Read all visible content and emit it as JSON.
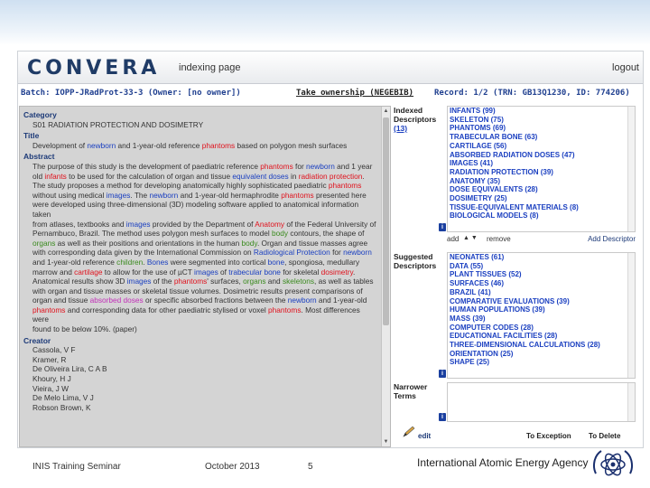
{
  "header": {
    "logo_text": "CONVERA",
    "title": "indexing page",
    "logout": "logout"
  },
  "infobar": {
    "batch": "Batch: IOPP-JRadProt-33-3 (Owner: [no owner])",
    "take_ownership": "Take ownership (NEGEBIB)",
    "record": "Record: 1/2 (TRN: GB13Q1230, ID: 774206)"
  },
  "record": {
    "category_label": "Category",
    "category_value": "S01 RADIATION PROTECTION AND DOSIMETRY",
    "title_label": "Title",
    "title_parts": [
      "Development of ",
      "newborn",
      " and 1-year-old reference ",
      "phantoms",
      " based on polygon mesh surfaces"
    ],
    "abstract_label": "Abstract",
    "abstract_lines": [
      [
        "The purpose of this study is the development of paediatric reference ",
        "phantoms",
        " for ",
        "newborn",
        " and 1 year"
      ],
      [
        "old ",
        "infants",
        " to be used for the calculation of organ and tissue ",
        "equivalent doses",
        " in ",
        "radiation protection",
        "."
      ],
      [
        "The study proposes a method for developing anatomically highly sophisticated paediatric ",
        "phantoms"
      ],
      [
        "without using medical ",
        "images",
        ". The ",
        "newborn",
        " and 1-year-old hermaphrodite ",
        "phantoms",
        " presented here"
      ],
      [
        "were developed using three-dimensional (3D) modeling software applied to anatomical information taken"
      ],
      [
        "from atlases, textbooks and ",
        "images",
        " provided by the Department of ",
        "Anatomy",
        " of the Federal University of"
      ],
      [
        "Pernambuco, Brazil. The method uses polygon mesh surfaces to model ",
        "body",
        " contours, the shape of"
      ],
      [
        "organs",
        " as well as their positions and orientations in the human ",
        "body",
        ". Organ and tissue masses agree"
      ],
      [
        "with corresponding data given by the International Commission on ",
        "Radiological Protection",
        " for ",
        "newborn"
      ],
      [
        "and 1-year-old reference ",
        "children",
        ". ",
        "Bones",
        " were segmented into cortical ",
        "bone",
        ", spongiosa, medullary"
      ],
      [
        "marrow and ",
        "cartilage",
        " to allow for the use of µCT ",
        "images",
        " of ",
        "trabecular bone",
        " for skeletal ",
        "dosimetry",
        "."
      ],
      [
        "Anatomical results show 3D ",
        "images",
        " of the ",
        "phantoms",
        "' surfaces, ",
        "organs",
        " and ",
        "skeletons",
        ", as well as tables"
      ],
      [
        "with organ and tissue masses or skeletal tissue volumes. Dosimetric results present comparisons of"
      ],
      [
        "organ and tissue ",
        "absorbed doses",
        " or specific absorbed fractions between the ",
        "newborn",
        " and 1-year-old"
      ],
      [
        "phantoms",
        " and corresponding data for other paediatric stylised or voxel ",
        "phantoms",
        ". Most differences were"
      ],
      [
        "found to be below 10%. (paper)"
      ]
    ],
    "creator_label": "Creator",
    "creators": [
      "Cassola, V F",
      "Kramer, R",
      "De Oliveira Lira, C A B",
      "Khoury, H J",
      "Vieira, J W",
      "De Melo Lima, V J",
      "Robson Brown, K"
    ]
  },
  "indexed": {
    "label": "Indexed Descriptors",
    "count": "(13)",
    "items": [
      "INFANTS (99)",
      "SKELETON (75)",
      "PHANTOMS (69)",
      "TRABECULAR BONE (63)",
      "CARTILAGE (56)",
      "ABSORBED RADIATION DOSES (47)",
      "IMAGES (41)",
      "RADIATION PROTECTION (39)",
      "ANATOMY (35)",
      "DOSE EQUIVALENTS (28)",
      "DOSIMETRY (25)",
      "TISSUE-EQUIVALENT MATERIALS (8)",
      "BIOLOGICAL MODELS (8)"
    ],
    "add_label": "add",
    "remove_label": "remove",
    "add_descriptor": "Add Descriptor"
  },
  "suggested": {
    "label": "Suggested Descriptors",
    "items": [
      "NEONATES (61)",
      "DATA (55)",
      "PLANT TISSUES (52)",
      "SURFACES (46)",
      "BRAZIL (41)",
      "COMPARATIVE EVALUATIONS (39)",
      "HUMAN POPULATIONS (39)",
      "MASS (39)",
      "COMPUTER CODES (28)",
      "EDUCATIONAL FACILITIES (28)",
      "THREE-DIMENSIONAL CALCULATIONS (28)",
      "ORIENTATION (25)",
      "SHAPE (25)"
    ]
  },
  "narrower": {
    "label": "Narrower Terms"
  },
  "footer_controls": {
    "edit": "edit",
    "to_exception": "To Exception",
    "to_delete": "To Delete"
  },
  "info_icon_glyph": "i",
  "slide_footer": {
    "seminar": "INIS Training Seminar",
    "date": "October  2013",
    "page": "5",
    "org": "International Atomic Energy Agency"
  },
  "colors": {
    "keyword_red": "#e0111c",
    "keyword_blue": "#1a3fc0",
    "keyword_green": "#3a8a1e",
    "keyword_magenta": "#c22fb8",
    "descriptor_blue": "#1a3fc0",
    "section_heading": "#1d3a78"
  },
  "icons": [
    "pencil-icon",
    "info-icon",
    "emblem-icon",
    "scroll-arrow-up-icon",
    "scroll-arrow-down-icon"
  ]
}
